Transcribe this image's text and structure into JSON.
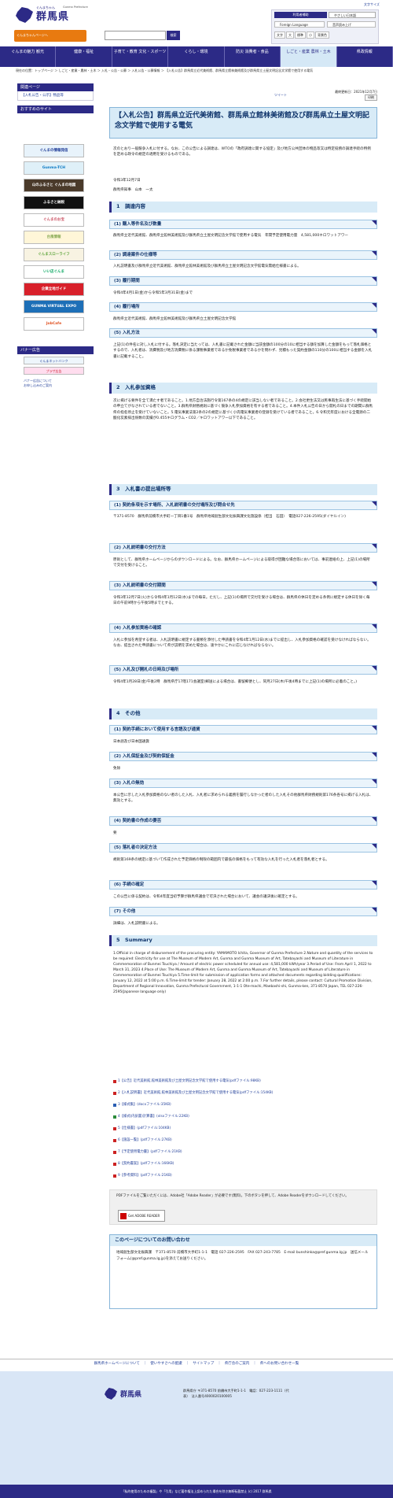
{
  "header": {
    "sub": "ぐんまちゃん",
    "name": "群馬県",
    "en": "Gunma Prefecture",
    "help": "文字サイズ",
    "mascot": "ぐんまちゃんページへ",
    "search_placeholder": "",
    "search_btn": "検索",
    "tools_title": "利用者補助",
    "select": "やさしい日本語",
    "lang": "Foreign Language",
    "lang2": "音声読み上げ",
    "row3": [
      "文字",
      "大",
      "標準",
      "小",
      "背景色"
    ]
  },
  "nav": [
    "ぐんまの魅力 観光",
    "健康・福祉",
    "子育て・教育 文化・スポーツ",
    "くらし・環境",
    "防災 消費者・食品",
    "しごと・産業 農林・土木",
    "県政情報"
  ],
  "crumb": "現在の位置：トップページ ＞ しごと・産業・農林・土木 ＞ 入札・公告・公募 ＞ 入札公告・公募情報 ＞ 【入札公告】群馬県立近代美術館、群馬県立館林美術館及び群馬県立土屋文明記念文学館で使用する電気",
  "side": {
    "related": "関連ページ",
    "related_link": "【入札公告・公示】物品等",
    "recommend": "おすすめのサイト",
    "banner_head": "バナー広告",
    "ad_link": "バナー広告について",
    "ad_link2": "お申し込みのご案内",
    "banners": [
      "ぐんまの情報発信",
      "Gunma-TCH",
      "山のふるさと ぐんまの地図",
      "ふるさと納税",
      "ぐんまのお宝",
      "台風情報",
      "ぐんまスローライフ",
      "いい店ぐんま",
      "企業立地ガイド",
      "GUNMA VIRTUAL EXPO",
      "JobCafe"
    ],
    "ads": [
      "ぐんまネットバンク",
      "プラザ広告"
    ]
  },
  "main": {
    "date": "最終更新日：2021年12月7日",
    "print": "印刷",
    "tweet": "ツイート",
    "title": "【入札公告】群馬県立近代美術館、群馬県立館林美術館及び群馬県立土屋文明記念文学館で使用する電気",
    "intro": "次のとおり一般競争入札に付する。なお、この公告による調達は、WTOの「政府調達に関する協定」及び地方公共団体の物品等又は特定役務の調達手続の特例を定める政令の規定の適用を受けるものである。",
    "date2": "令和3年12月7日",
    "gov": "群馬県知事　山本　一太",
    "s1": "1　調達内容",
    "s1_1": "(1) 購入等件名及び数量",
    "s1_1t": "群馬県立近代美術館、群馬県立館林美術館及び群馬県立土屋文明記念文学館で使用する電気　年間予定使用電力量　4,581,000キロワットアワー",
    "s1_2": "(2) 調達案件の仕様等",
    "s1_2t": "入札説明書及び群馬県立近代美術館、群馬県立館林美術館及び群馬県立土屋文明記念文学館電気需給仕様書による。",
    "s1_3": "(3) 履行期間",
    "s1_3t": "令和4年4月1日(金)から令和5年3月31日(金)まで",
    "s1_4": "(4) 履行場所",
    "s1_4t": "群馬県立近代美術館、群馬県立館林美術館及び群馬県立土屋文明記念文学館",
    "s1_5": "(5) 入札方法",
    "s1_5t": "上記(1)の件名に対し入札に付する。落札決定に当たっては、入札書に記載された金額に当該金額の100分の10に相当する額を加算した金額をもって落札価格とするので、入札者は、消費税及び地方消費税に係る課税事業者であるか免税事業者であるかを問わず、見積もった契約金額の110分の100に相当する金額を入札書に記載すること。",
    "s2": "2　入札参加資格",
    "s2t": "次に掲げる要件を全て満たす者であること。1.地方自治法施行令第167条の4の規定に該当しない者であること。2.会社更生法又は民事再生法に基づく手続開始の申立てがなされている者でないこと。3.群馬県財務規則に基づく競争入札参加資格を有する者であること。4.本件入札公告の日から開札の日までの期間に群馬県の指名停止を受けていないこと。5.電気事業法第2条の2の規定に基づく小売電気事業者の登録を受けている者であること。6.令和元年度における全電源の二酸化炭素排出係数の実績が0.455キログラム・CO2／キロワットアワー以下であること。",
    "s3": "3　入札書の提出場所等",
    "s3_1": "(1) 契約条項を示す場所、入札説明書の交付場所及び問合せ先",
    "s3_1t": "〒371-8570　群馬県前橋市大手町一丁目1番1号　群馬県地域創生部文化振興課文化施設係（担当　石田）　電話027-226-2595(ダイヤルイン)",
    "s3_2": "(2) 入札説明書の交付方法",
    "s3_2t": "原則として、群馬県ホームページからのダウンロードによる。なお、群馬県ホームページによる取得が困難な場合等においては、事前連絡の上、上記(1)の場所で交付を受けること。",
    "s3_3": "(3) 入札説明書の交付期間",
    "s3_3t": "令和3年12月7日(火)から令和4年1月12日(水)までの毎日。ただし、上記(1)の場所で交付を受ける場合は、群馬県の休日を定める条例に規定する休日を除く毎日の午前9時から午後5時までとする。",
    "s3_4": "(4) 入札参加資格の確認",
    "s3_4t": "入札に参加を希望する者は、入札説明書に規定する書類を添付した申請書を令和4年1月12日(水)までに提出し、入札参加資格の確認を受けなければならない。なお、提出された申請書について県が説明を求めた場合は、速やかにこれに応じなければならない。",
    "s3_5": "(5) 入札及び開札の日時及び場所",
    "s3_5t": "令和4年1月28日(金)午後2時　群馬県庁17階171会議室(郵送による場合は、書留郵便とし、同月27日(木)午後4時までに上記(1)の場所に必着のこと。)",
    "s4": "4　その他",
    "s4_1": "(1) 契約手続において使用する言語及び通貨",
    "s4_1t": "日本語及び日本国通貨",
    "s4_2": "(2) 入札保証金及び契約保証金",
    "s4_2t": "免除",
    "s4_3": "(3) 入札の無効",
    "s4_3t": "本公告に示した入札参加資格のない者のした入札、入札者に求められる義務を履行しなかった者のした入札その他群馬県財務規則第176条各号に掲げる入札は、無効とする。",
    "s4_4": "(4) 契約書の作成の要否",
    "s4_4t": "要",
    "s4_5": "(5) 落札者の決定方法",
    "s4_5t": "規則第169条の規定に基づいて作成された予定価格の制限の範囲内で最低の価格をもって有効な入札を行った入札者を落札者とする。",
    "s4_6": "(6) 手続の確定",
    "s4_6t": "この公告に係る契約は、令和4年度当初予算が群馬県議会で可決された場合において、議会の議決後に確定とする。",
    "s4_7": "(7) その他",
    "s4_7t": "詳細は、入札説明書による。",
    "s5": "5　Summary",
    "s5t": "1.Official in charge of disbursement of the procuring entity: YAMAMOTO Ichita, Governor of Gunma Prefecture 2.Nature and quantity of the services to be required: Electricity for use at The Museum of Modern Art, Gunma and Gunma Museum of Art, Tatebayashi and Museum of Literature in Commemoration of Bunmei Tsuchiya / Amount of electric power scheduled for annual use: 4,581,000 kWh/year 3.Period of Use: From April 1, 2022 to March 31, 2023 4.Place of Use: The Museum of Modern Art, Gunma and Gunma Museum of Art, Tatebayashi and Museum of Literature in Commemoration of Bunmei Tsuchiya 5.Time-limit for submission of application forms and attached documents regarding bidding qualifications: January 12, 2022 at 5:00 p.m. 6.Time-limit for tender: January 28, 2022 at 2:00 p.m. 7.For further details, please contact: Cultural Promotion Division, Department of Regional Innovation, Gunma Prefectural Government, 1-1-1 Ote-machi, Maebashi-shi, Gunma-ken, 371-8570 Japan, TEL 027-226-2595(Japanese language only)",
    "dls": [
      "1【公告】近代美術館,館林美術館及び土屋文明記念文学館で使用する電気(pdfファイル:98KB)",
      "2【入札説明書】近代美術館,館林美術館及び土屋文明記念文学館で使用する電気(pdfファイル:154KB)",
      "3【様式集】(docxファイル:35KB)",
      "4【様式(内訳書)計算書】(xlsxファイル:22KB)",
      "5【仕様書】(pdfファイル:104KB)",
      "6【施設一覧】(pdfファイル:27KB)",
      "7【予定使用電力量】(pdfファイル:21KB)",
      "8【契約書案】(pdfファイル:166KB)",
      "9【参考資料】(pdfファイル:21KB)"
    ],
    "pdf_note": "PDFファイルをご覧いただくには、Adobe社「Adobe Reader」が必要です(無料)。下のボタンを押して、Adobe Readerをダウンロードしてください。",
    "adobe": "Get ADOBE READER",
    "contact_head": "このページについてのお問い合わせ",
    "contact": "地域創生部文化振興課　〒371-8570 前橋市大手町1-1-1　電話 027-226-2595　FAX 027-243-7785　E-mail bunshinka@pref.gunma.lg.jp　送信メールフォーム(@pref.gunma.lg.jp)を添えてお送りください。"
  },
  "fnav": "群馬県ホームページについて　｜　使いやすさへの配慮　｜　サイトマップ　｜　県庁舎のご案内　｜　県へのお問い合わせ一覧",
  "footer": {
    "name": "群馬県",
    "addr": "群馬県庁 〒371-8570 前橋市大手町1-1-1　電話：027-223-1111（代表）　法人番号4000020100005",
    "copy": "「私的使用のための複製」や「引用」など著作権法上認められた場合を除き無断転載禁止 (c) 2017 群馬県"
  }
}
